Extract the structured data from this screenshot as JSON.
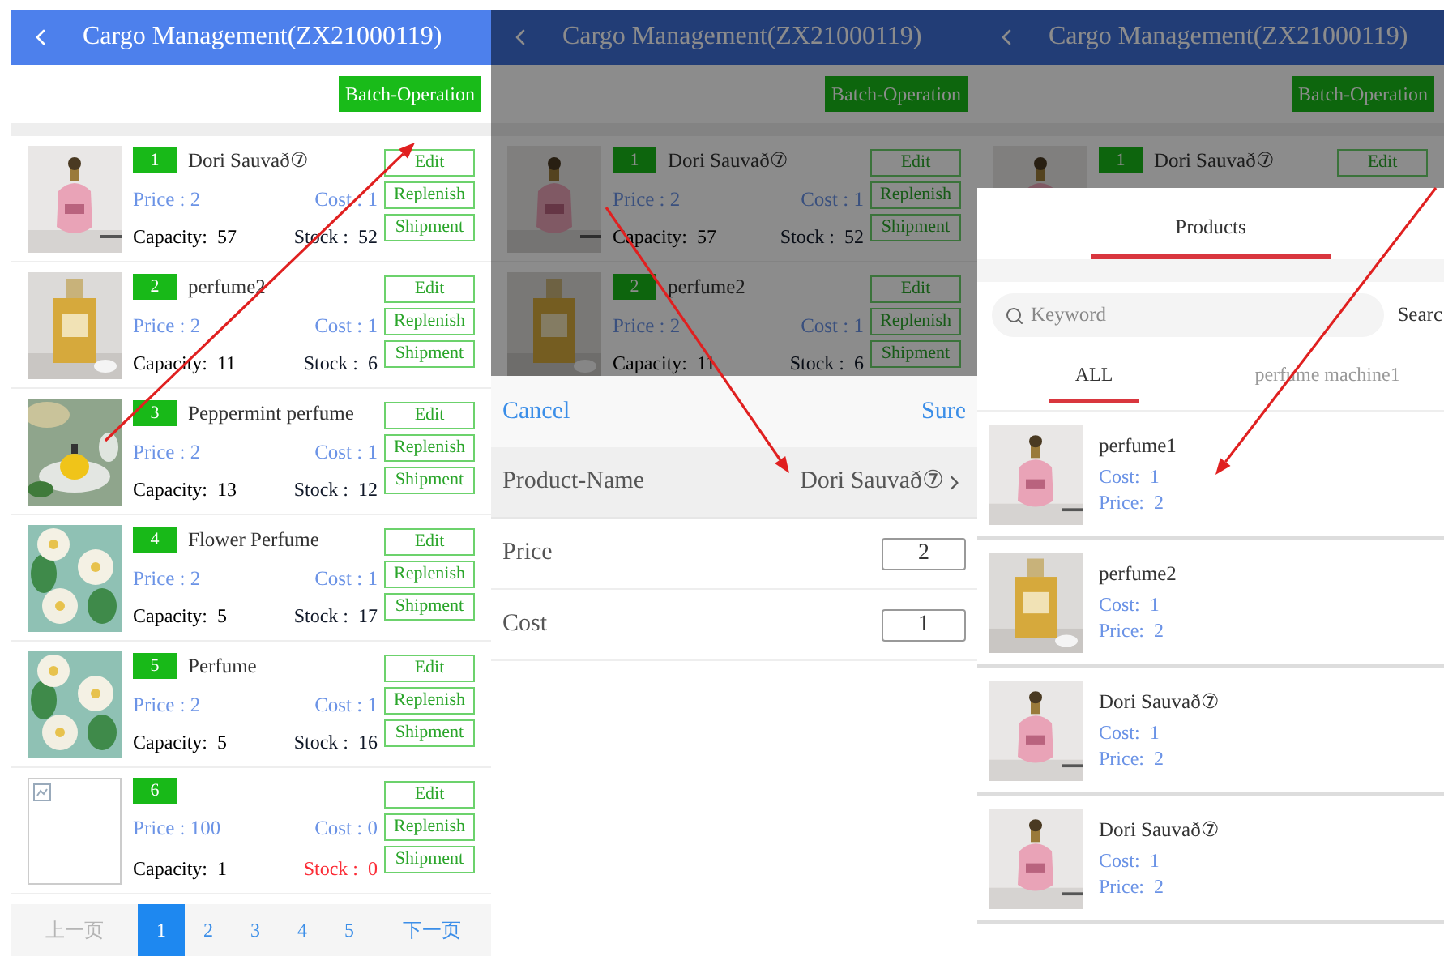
{
  "screens": [
    {
      "dimmed": false,
      "header": {
        "title": "Cargo Management(ZX21000119)"
      },
      "batch_button": "Batch-Operation",
      "products": [
        {
          "kind": "picture",
          "number": "1",
          "name": "Dori Sauvað⑦",
          "price": "Price : 2",
          "cost": "Cost : 1",
          "capacity": "Capacity:  57",
          "stock": "Stock :  52",
          "stock_alert": false,
          "buttons": [
            "Edit",
            "Replenish",
            "Shipment"
          ]
        },
        {
          "kind": "picture",
          "number": "2",
          "name": "perfume2",
          "price": "Price : 2",
          "cost": "Cost : 1",
          "capacity": "Capacity:  11",
          "stock": "Stock :  6",
          "stock_alert": false,
          "buttons": [
            "Edit",
            "Replenish",
            "Shipment"
          ]
        },
        {
          "kind": "picture",
          "number": "3",
          "name": "Peppermint perfume",
          "price": "Price : 2",
          "cost": "Cost : 1",
          "capacity": "Capacity:  13",
          "stock": "Stock :  12",
          "stock_alert": false,
          "buttons": [
            "Edit",
            "Replenish",
            "Shipment"
          ]
        },
        {
          "kind": "picture",
          "number": "4",
          "name": "Flower Perfume",
          "price": "Price : 2",
          "cost": "Cost : 1",
          "capacity": "Capacity:  5",
          "stock": "Stock :  17",
          "stock_alert": false,
          "buttons": [
            "Edit",
            "Replenish",
            "Shipment"
          ]
        },
        {
          "kind": "picture",
          "number": "5",
          "name": "Perfume",
          "price": "Price : 2",
          "cost": "Cost : 1",
          "capacity": "Capacity:  5",
          "stock": "Stock :  16",
          "stock_alert": false,
          "buttons": [
            "Edit",
            "Replenish",
            "Shipment"
          ]
        },
        {
          "kind": "broken_image",
          "number": "6",
          "price": "Price : 100",
          "cost": "Cost : 0",
          "capacity": "Capacity:  1",
          "stock": "Stock :  0",
          "stock_alert": true,
          "buttons": [
            "Edit",
            "Replenish",
            "Shipment"
          ]
        }
      ],
      "pagination": {
        "prev": {
          "label": "上一页",
          "disabled": true
        },
        "pages": [
          {
            "label": "1",
            "selected": true
          },
          {
            "label": "2",
            "selected": false
          },
          {
            "label": "3",
            "selected": false
          },
          {
            "label": "4",
            "selected": false
          },
          {
            "label": "5",
            "selected": false
          }
        ],
        "next": {
          "label": "下一页",
          "disabled": false
        }
      }
    },
    {
      "dimmed": true,
      "header": {
        "title": "Cargo Management(ZX21000119)"
      },
      "batch_button": "Batch-Operation",
      "products": [
        {
          "kind": "picture",
          "number": "1",
          "name": "Dori Sauvað⑦",
          "price": "Price : 2",
          "cost": "Cost : 1",
          "capacity": "Capacity:  57",
          "stock": "Stock :  52",
          "stock_alert": false,
          "buttons": [
            "Edit",
            "Replenish",
            "Shipment"
          ]
        },
        {
          "kind": "picture",
          "number": "2",
          "name": "perfume2",
          "price": "Price : 2",
          "cost": "Cost : 1",
          "capacity": "Capacity:  11",
          "stock": "Stock :  6",
          "stock_alert": false,
          "buttons": [
            "Edit",
            "Replenish",
            "Shipment"
          ]
        }
      ],
      "overlay": {
        "kind": "edit_sheet",
        "cancel": "Cancel",
        "confirm": "Sure",
        "fields": [
          {
            "kind": "select",
            "label": "Product-Name",
            "value": "Dori Sauvað⑦"
          },
          {
            "kind": "number",
            "label": "Price",
            "value": "2"
          },
          {
            "kind": "number",
            "label": "Cost",
            "value": "1"
          }
        ]
      }
    },
    {
      "dimmed": true,
      "header": {
        "title": "Cargo Management(ZX21000119)"
      },
      "batch_button": "Batch-Operation",
      "products": [
        {
          "kind": "picture",
          "number": "1",
          "name": "Dori Sauvað⑦",
          "buttons": [
            "Edit"
          ]
        }
      ],
      "overlay": {
        "kind": "product_picker",
        "title": "Products",
        "search": {
          "placeholder": "Keyword",
          "button": "Searc"
        },
        "tabs": [
          {
            "label": "ALL",
            "selected": true
          },
          {
            "label": "perfume machine1",
            "selected": false
          }
        ],
        "items": [
          {
            "name": "perfume1",
            "cost": "Cost:  1",
            "price": "Price:  2"
          },
          {
            "name": "perfume2",
            "cost": "Cost:  1",
            "price": "Price:  2"
          },
          {
            "name": "Dori Sauvað⑦",
            "cost": "Cost:  1",
            "price": "Price:  2"
          },
          {
            "name": "Dori Sauvað⑦",
            "cost": "Cost:  1",
            "price": "Price:  2"
          }
        ]
      }
    }
  ]
}
